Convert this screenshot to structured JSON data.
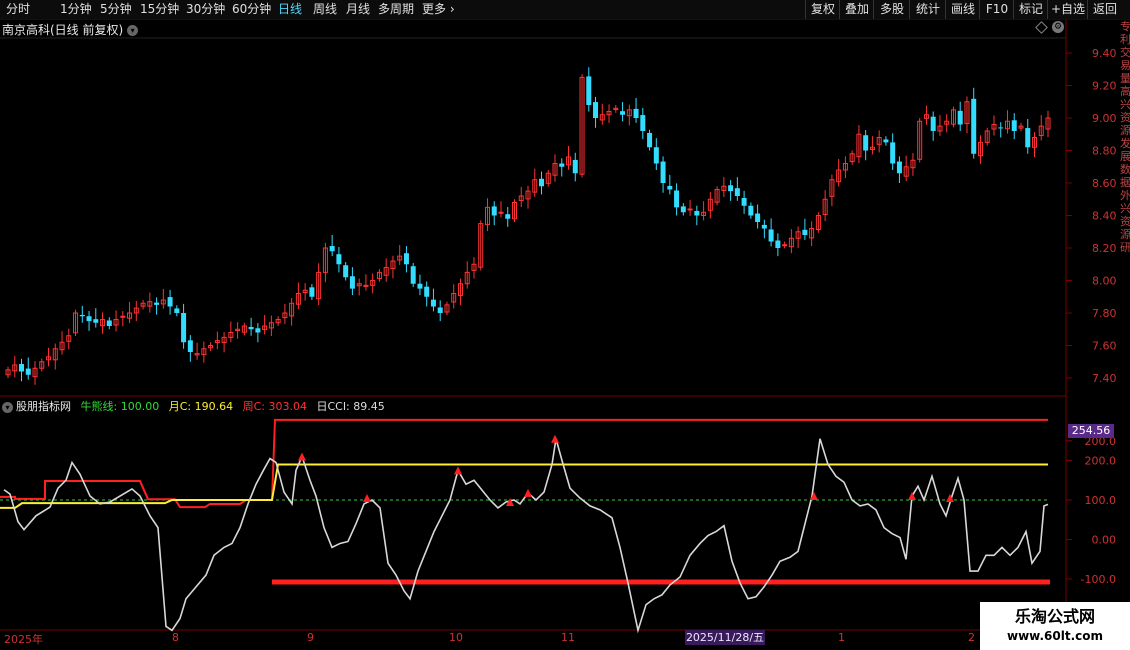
{
  "toolbar": {
    "periods": [
      "分时",
      "1分钟",
      "5分钟",
      "15分钟",
      "30分钟",
      "60分钟",
      "日线",
      "周线",
      "月线",
      "多周期",
      "更多"
    ],
    "active": "日线",
    "right_buttons": [
      "复权",
      "叠加",
      "多股",
      "统计",
      "画线",
      "F10",
      "标记",
      "+自选",
      "返回"
    ]
  },
  "main": {
    "title": "南京高科(日线 前复权)",
    "price_labels": [
      "9.40",
      "9.20",
      "9.00",
      "8.80",
      "8.60",
      "8.40",
      "8.20",
      "8.00",
      "7.80",
      "7.60",
      "7.40"
    ],
    "sideband_text": "专利交易量高兴资源发展数据外兴资源研"
  },
  "indicator": {
    "name": "股朋指标网",
    "legend": [
      {
        "label": "牛熊线: 100.00",
        "color": "#33dd33"
      },
      {
        "label": "月C: 190.64",
        "color": "#ffee33"
      },
      {
        "label": "周C: 303.04",
        "color": "#ff3333"
      },
      {
        "label": "日CCI: 89.45",
        "color": "#dddddd"
      }
    ],
    "axis_labels": [
      "200.0",
      "200.0",
      "100.0",
      "0.00",
      "-100.0"
    ],
    "current_value": "254.56"
  },
  "xaxis": {
    "labels": [
      {
        "text": "2025年"
      },
      {
        "text": "8"
      },
      {
        "text": "9"
      },
      {
        "text": "10"
      },
      {
        "text": "11"
      },
      {
        "text": "1"
      },
      {
        "text": "2"
      }
    ],
    "highlight_date": "2025/11/28/五"
  },
  "watermark": {
    "line1": "乐淘公式网",
    "line2": "www.60lt.com"
  },
  "colors": {
    "up": "#ff3333",
    "down": "#33ddff",
    "cci": "#d8d8d8",
    "yellow": "#ffee33",
    "red": "#ff2020",
    "green": "#33cc33"
  }
}
